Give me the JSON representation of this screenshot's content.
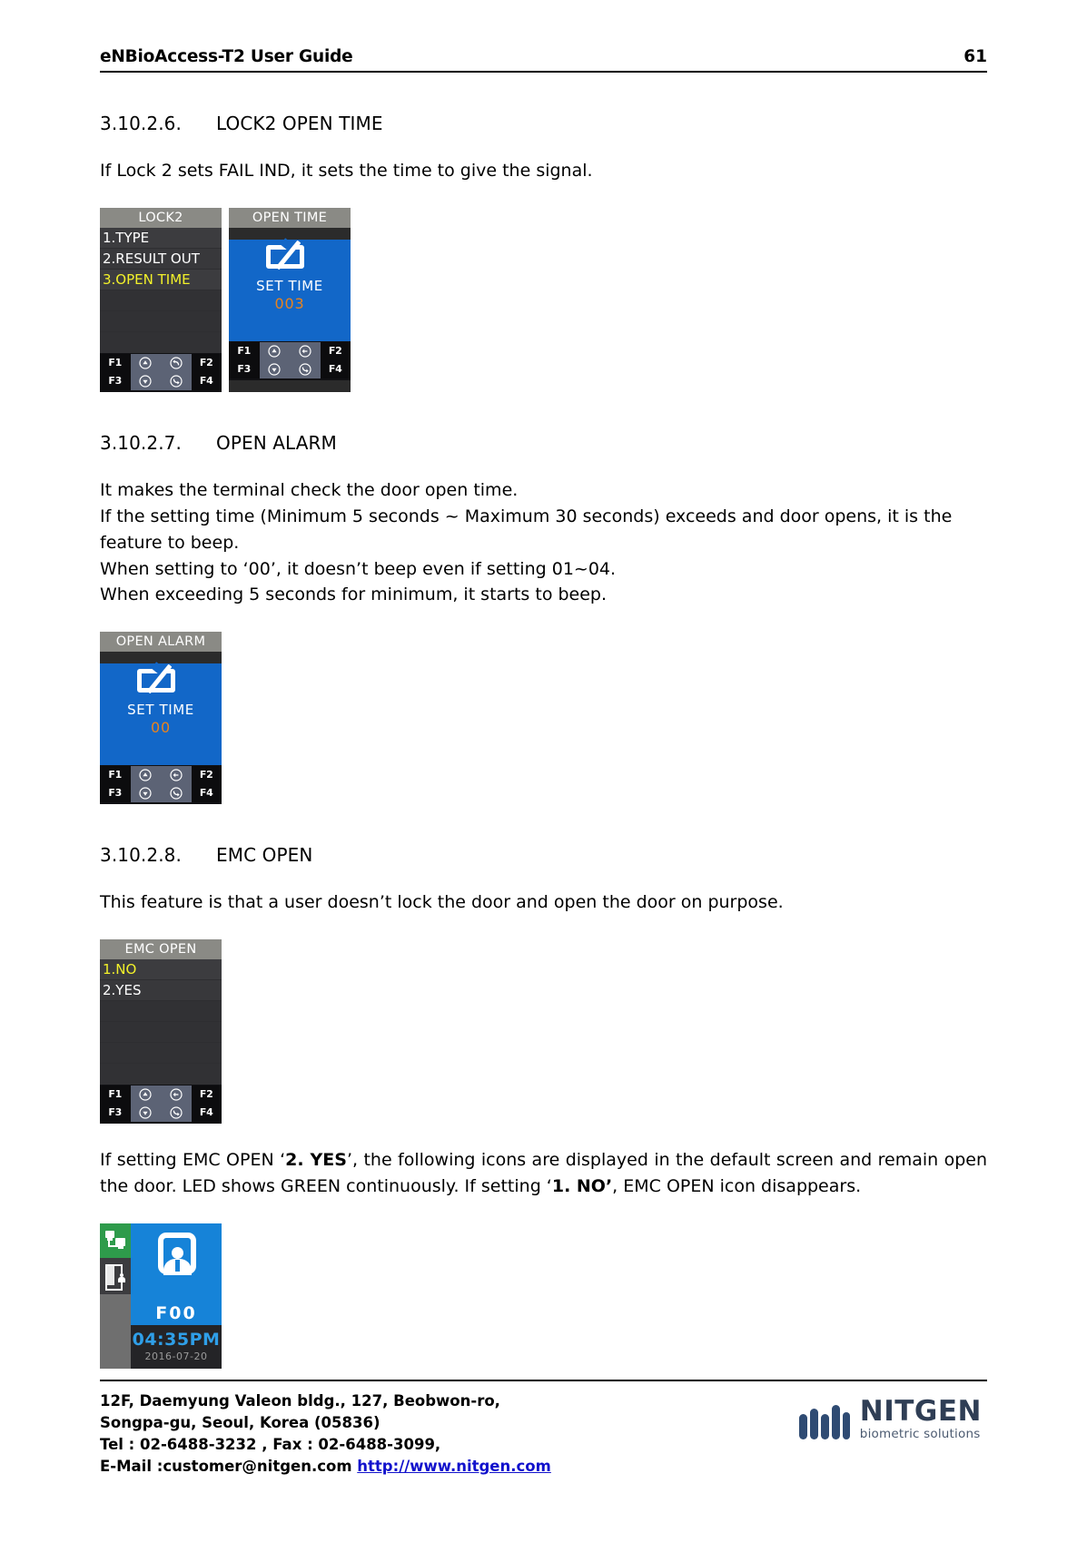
{
  "header": {
    "title": "eNBioAccess-T2 User Guide",
    "page_number": "61"
  },
  "sections": [
    {
      "number": "3.10.2.6.",
      "title": "LOCK2 OPEN TIME",
      "body": "If Lock 2 sets FAIL IND, it sets the time to give the signal."
    },
    {
      "number": "3.10.2.7.",
      "title": "OPEN ALARM",
      "body_line1": "It makes the terminal check the door open time.",
      "body_line2": "If the setting time (Minimum 5 seconds ~ Maximum 30 seconds) exceeds and door opens, it is the feature to beep.",
      "body_line3": "When setting to ‘00’, it doesn’t beep even if setting 01~04.",
      "body_line4": "When exceeding 5 seconds for minimum, it starts to beep."
    },
    {
      "number": "3.10.2.8.",
      "title": "EMC OPEN",
      "body": "This feature is that a user doesn’t lock the door and open the door on purpose."
    }
  ],
  "emc_note": {
    "part1": "If setting EMC OPEN ‘",
    "bold1": "2. YES",
    "part2": "’, the following icons are displayed in the default screen and remain open the door. LED shows GREEN continuously. If setting ‘",
    "bold2": "1. NO’",
    "part3": ", EMC OPEN icon disappears."
  },
  "screens": {
    "lock2_menu": {
      "title": "LOCK2",
      "items": [
        "1.TYPE",
        "2.RESULT OUT",
        "3.OPEN TIME"
      ],
      "selected_index": 2
    },
    "open_time": {
      "title": "OPEN TIME",
      "label": "SET TIME",
      "value": "003"
    },
    "open_alarm": {
      "title": "OPEN ALARM",
      "label": "SET TIME",
      "value": "00"
    },
    "emc_open_menu": {
      "title": "EMC OPEN",
      "items": [
        "1.NO",
        "2.YES"
      ],
      "selected_index": 0
    },
    "default_screen": {
      "function_code": "F00",
      "time": "04:35PM",
      "date": "2016-07-20"
    }
  },
  "keypad": {
    "f1": "F1",
    "f2": "F2",
    "f3": "F3",
    "f4": "F4",
    "up": "up-arrow",
    "down": "down-arrow",
    "back": "back-arrow",
    "left": "left-arrow",
    "right": "right-arrow"
  },
  "footer": {
    "line1": "12F, Daemyung Valeon bldg., 127, Beobwon-ro,",
    "line2": "Songpa-gu, Seoul, Korea (05836)",
    "line3": "Tel : 02-6488-3232 , Fax : 02-6488-3099,",
    "line4_label": "E-Mail :customer@nitgen.com ",
    "line4_link": "http://www.nitgen.com",
    "logo_word": "NITGEN",
    "logo_sub": "biometric solutions"
  },
  "colors": {
    "lcd_blue": "#1267c8",
    "lcd_title_gray": "#8a8a85",
    "lcd_selected_yellow": "#f2f12a",
    "lcd_value_orange": "#e8831e",
    "link_blue": "#1111cc"
  }
}
